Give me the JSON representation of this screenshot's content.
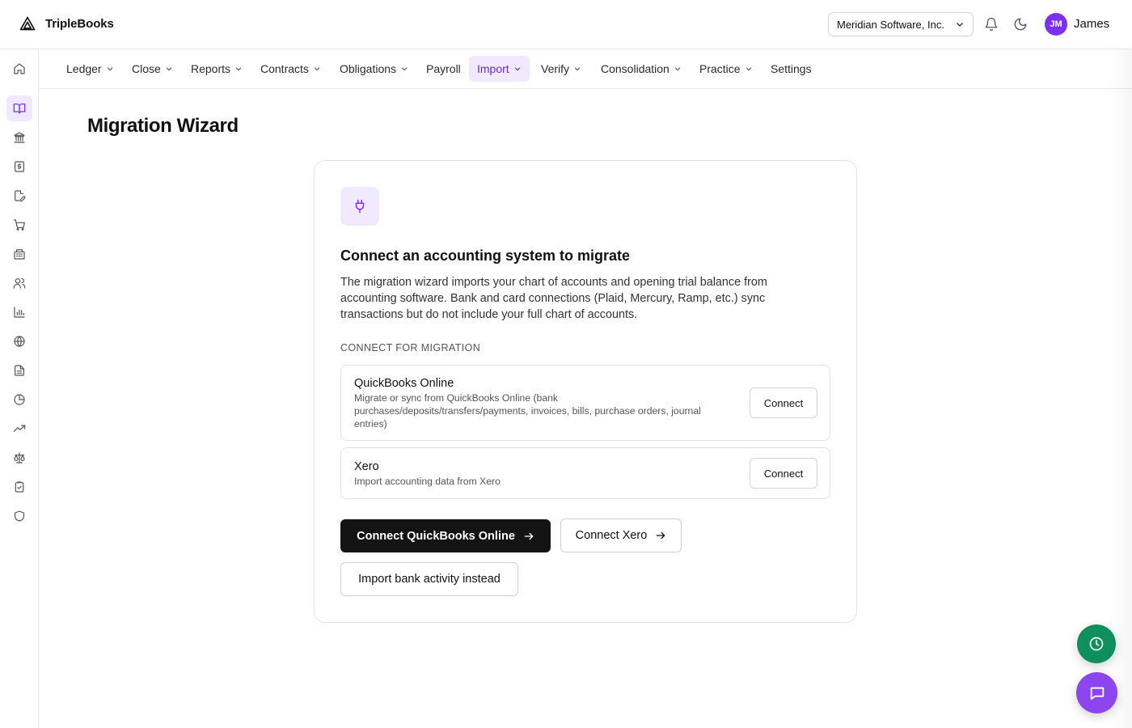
{
  "app": {
    "name": "TripleBooks"
  },
  "header": {
    "company": "Meridian Software, Inc.",
    "user_initials": "JM",
    "user_name": "James"
  },
  "colors": {
    "accent": "#7b2ff7",
    "accent_soft": "#f1e9fe",
    "primary": "#141414",
    "fab_green": "#0f8f5b",
    "fab_purple": "#8b46f0"
  },
  "sidebar": {
    "items": [
      {
        "icon": "home-icon"
      },
      {
        "icon": "book-open-icon",
        "active": true
      },
      {
        "icon": "bank-icon"
      },
      {
        "icon": "receipt-dollar-icon"
      },
      {
        "icon": "document-edit-icon"
      },
      {
        "icon": "shopping-cart-icon"
      },
      {
        "icon": "building-icon"
      },
      {
        "icon": "users-icon"
      },
      {
        "icon": "bar-chart-icon"
      },
      {
        "icon": "globe-icon"
      },
      {
        "icon": "document-icon"
      },
      {
        "icon": "pie-chart-icon"
      },
      {
        "icon": "trending-up-icon"
      },
      {
        "icon": "scale-icon"
      },
      {
        "icon": "clipboard-check-icon"
      },
      {
        "icon": "shield-icon"
      }
    ]
  },
  "nav": {
    "items": [
      {
        "label": "Ledger",
        "dropdown": true
      },
      {
        "label": "Close",
        "dropdown": true
      },
      {
        "label": "Reports",
        "dropdown": true
      },
      {
        "label": "Contracts",
        "dropdown": true
      },
      {
        "label": "Obligations",
        "dropdown": true
      },
      {
        "label": "Payroll",
        "dropdown": false
      },
      {
        "label": "Import",
        "dropdown": true,
        "active": true
      },
      {
        "label": "Verify",
        "dropdown": true
      },
      {
        "label": "Consolidation",
        "dropdown": true
      },
      {
        "label": "Practice",
        "dropdown": true
      },
      {
        "label": "Settings",
        "dropdown": false
      }
    ]
  },
  "page": {
    "title": "Migration Wizard"
  },
  "card": {
    "title": "Connect an accounting system to migrate",
    "description": "The migration wizard imports your chart of accounts and opening trial balance from accounting software. Bank and card connections (Plaid, Mercury, Ramp, etc.) sync transactions but do not include your full chart of accounts.",
    "section_label": "CONNECT FOR MIGRATION",
    "providers": [
      {
        "name": "QuickBooks Online",
        "description": "Migrate or sync from QuickBooks Online (bank purchases/deposits/transfers/payments, invoices, bills, purchase orders, journal entries)",
        "button": "Connect"
      },
      {
        "name": "Xero",
        "description": "Import accounting data from Xero",
        "button": "Connect"
      }
    ],
    "primary_button": "Connect QuickBooks Online",
    "secondary_button": "Connect Xero",
    "tertiary_button": "Import bank activity instead"
  },
  "fabs": [
    {
      "icon": "clock-icon"
    },
    {
      "icon": "chat-icon"
    }
  ]
}
